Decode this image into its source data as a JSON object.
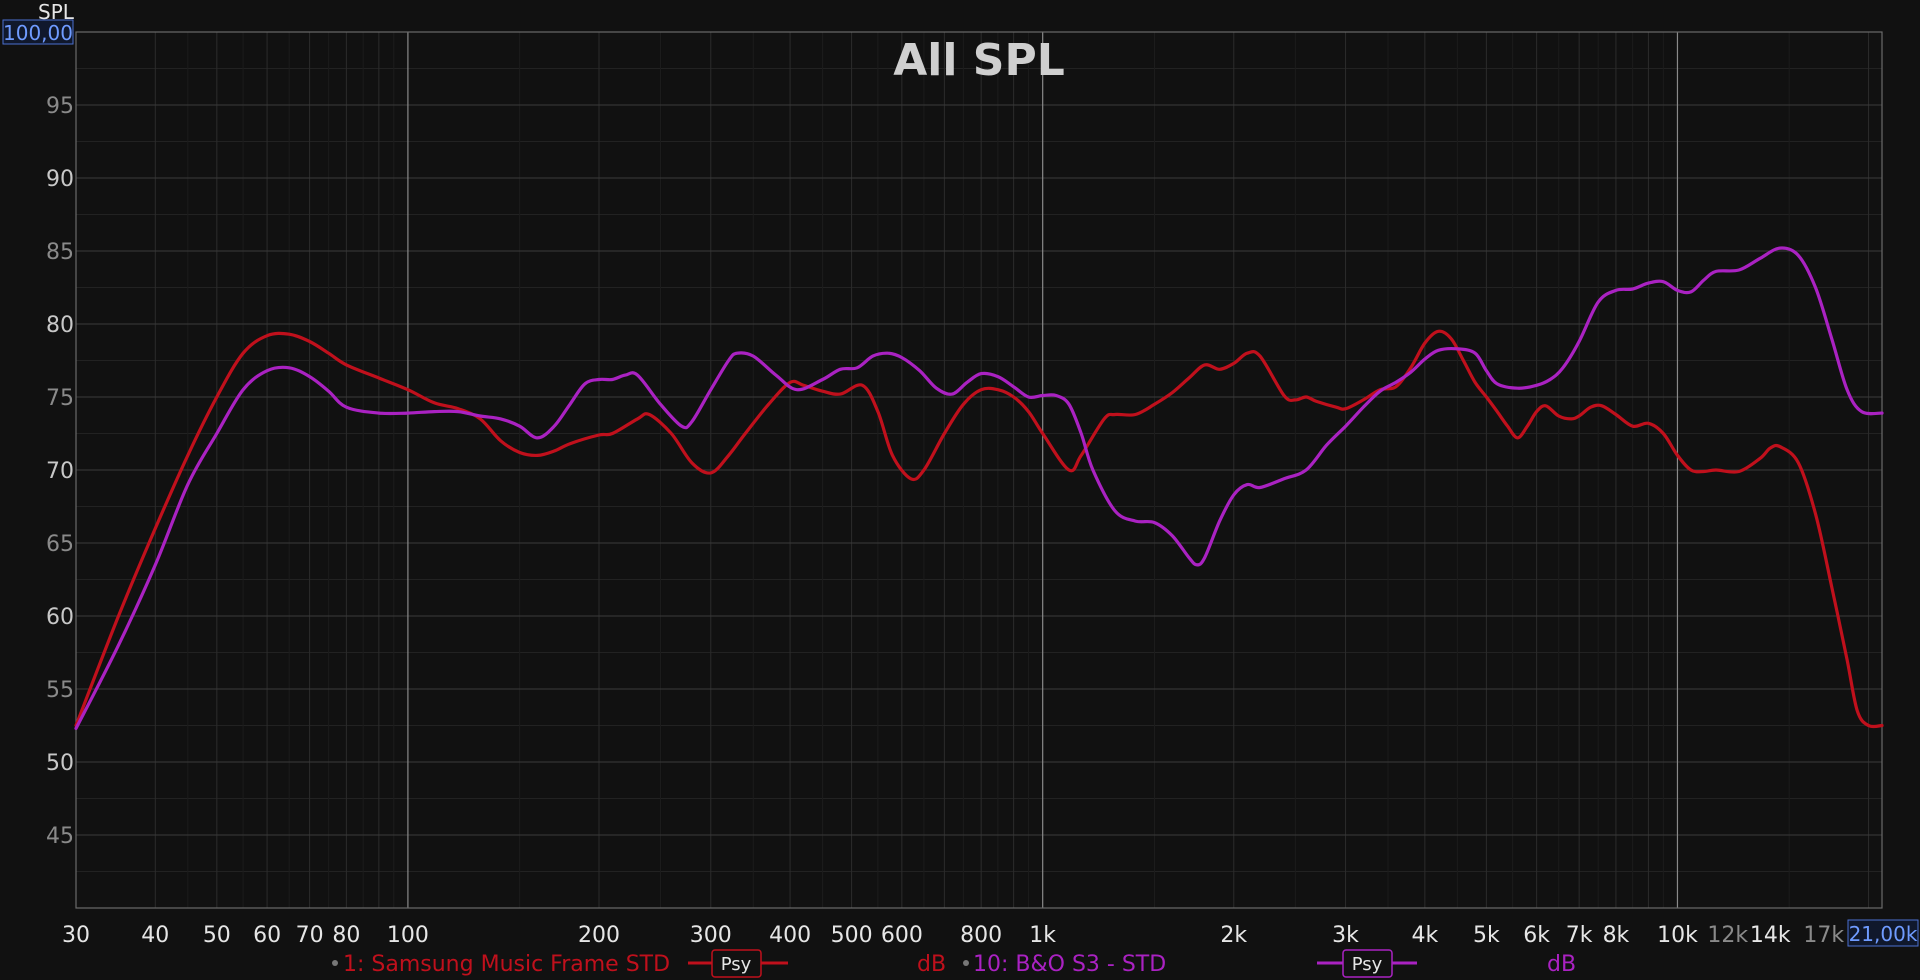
{
  "chart_data": {
    "type": "line",
    "title": "All SPL",
    "ylabel": "SPL",
    "xscale": "log",
    "xlim": [
      30,
      21000
    ],
    "ylim": [
      40,
      100
    ],
    "grid": true,
    "y_top_readout": "100,00",
    "x_right_readout": "21,00k",
    "y_ticks": [
      {
        "value": 95,
        "label": "95",
        "dim": true
      },
      {
        "value": 90,
        "label": "90",
        "dim": false
      },
      {
        "value": 85,
        "label": "85",
        "dim": true
      },
      {
        "value": 80,
        "label": "80",
        "dim": false
      },
      {
        "value": 75,
        "label": "75",
        "dim": true
      },
      {
        "value": 70,
        "label": "70",
        "dim": false
      },
      {
        "value": 65,
        "label": "65",
        "dim": true
      },
      {
        "value": 60,
        "label": "60",
        "dim": false
      },
      {
        "value": 55,
        "label": "55",
        "dim": true
      },
      {
        "value": 50,
        "label": "50",
        "dim": false
      },
      {
        "value": 45,
        "label": "45",
        "dim": true
      }
    ],
    "x_ticks": [
      {
        "value": 30,
        "label": "30",
        "dim": false
      },
      {
        "value": 40,
        "label": "40",
        "dim": false
      },
      {
        "value": 50,
        "label": "50",
        "dim": false
      },
      {
        "value": 60,
        "label": "60",
        "dim": false
      },
      {
        "value": 70,
        "label": "70",
        "dim": false
      },
      {
        "value": 80,
        "label": "80",
        "dim": false
      },
      {
        "value": 100,
        "label": "100",
        "dim": false
      },
      {
        "value": 200,
        "label": "200",
        "dim": false
      },
      {
        "value": 300,
        "label": "300",
        "dim": false
      },
      {
        "value": 400,
        "label": "400",
        "dim": false
      },
      {
        "value": 500,
        "label": "500",
        "dim": false
      },
      {
        "value": 600,
        "label": "600",
        "dim": false
      },
      {
        "value": 800,
        "label": "800",
        "dim": false
      },
      {
        "value": 1000,
        "label": "1k",
        "dim": false
      },
      {
        "value": 2000,
        "label": "2k",
        "dim": false
      },
      {
        "value": 3000,
        "label": "3k",
        "dim": false
      },
      {
        "value": 4000,
        "label": "4k",
        "dim": false
      },
      {
        "value": 5000,
        "label": "5k",
        "dim": false
      },
      {
        "value": 6000,
        "label": "6k",
        "dim": false
      },
      {
        "value": 7000,
        "label": "7k",
        "dim": false
      },
      {
        "value": 8000,
        "label": "8k",
        "dim": false
      },
      {
        "value": 10000,
        "label": "10k",
        "dim": false
      },
      {
        "value": 12000,
        "label": "12k",
        "dim": true
      },
      {
        "value": 14000,
        "label": "14k",
        "dim": false
      },
      {
        "value": 17000,
        "label": "17k",
        "dim": true
      }
    ],
    "series": [
      {
        "name": "1: Samsung Music Frame STD",
        "color": "#c0101c",
        "unit": "dB",
        "psy_label": "Psy",
        "points": [
          [
            30,
            52.5
          ],
          [
            35,
            60
          ],
          [
            40,
            66
          ],
          [
            45,
            71
          ],
          [
            50,
            75
          ],
          [
            55,
            78
          ],
          [
            60,
            79.2
          ],
          [
            65,
            79.3
          ],
          [
            70,
            78.8
          ],
          [
            75,
            78
          ],
          [
            80,
            77.2
          ],
          [
            90,
            76.3
          ],
          [
            100,
            75.5
          ],
          [
            110,
            74.6
          ],
          [
            120,
            74.2
          ],
          [
            130,
            73.5
          ],
          [
            140,
            72
          ],
          [
            150,
            71.2
          ],
          [
            160,
            71
          ],
          [
            170,
            71.3
          ],
          [
            180,
            71.8
          ],
          [
            200,
            72.4
          ],
          [
            210,
            72.5
          ],
          [
            230,
            73.5
          ],
          [
            240,
            73.8
          ],
          [
            260,
            72.5
          ],
          [
            280,
            70.5
          ],
          [
            300,
            69.8
          ],
          [
            320,
            71
          ],
          [
            340,
            72.5
          ],
          [
            370,
            74.5
          ],
          [
            400,
            76
          ],
          [
            420,
            75.8
          ],
          [
            450,
            75.4
          ],
          [
            480,
            75.2
          ],
          [
            520,
            75.8
          ],
          [
            550,
            74
          ],
          [
            580,
            71
          ],
          [
            620,
            69.4
          ],
          [
            650,
            70
          ],
          [
            700,
            72.5
          ],
          [
            750,
            74.5
          ],
          [
            800,
            75.5
          ],
          [
            850,
            75.5
          ],
          [
            900,
            75
          ],
          [
            950,
            74
          ],
          [
            1000,
            72.5
          ],
          [
            1100,
            70
          ],
          [
            1150,
            71
          ],
          [
            1250,
            73.5
          ],
          [
            1300,
            73.8
          ],
          [
            1400,
            73.8
          ],
          [
            1500,
            74.5
          ],
          [
            1600,
            75.3
          ],
          [
            1700,
            76.3
          ],
          [
            1800,
            77.2
          ],
          [
            1900,
            76.9
          ],
          [
            2000,
            77.3
          ],
          [
            2100,
            78
          ],
          [
            2200,
            77.8
          ],
          [
            2400,
            75.1
          ],
          [
            2500,
            74.8
          ],
          [
            2600,
            75
          ],
          [
            2700,
            74.7
          ],
          [
            2900,
            74.3
          ],
          [
            3000,
            74.2
          ],
          [
            3200,
            74.8
          ],
          [
            3400,
            75.5
          ],
          [
            3600,
            75.7
          ],
          [
            3800,
            77
          ],
          [
            4000,
            78.7
          ],
          [
            4200,
            79.5
          ],
          [
            4400,
            79
          ],
          [
            4600,
            77.5
          ],
          [
            4800,
            76
          ],
          [
            5000,
            75
          ],
          [
            5200,
            74
          ],
          [
            5400,
            73
          ],
          [
            5600,
            72.2
          ],
          [
            5800,
            73
          ],
          [
            6000,
            74
          ],
          [
            6200,
            74.4
          ],
          [
            6500,
            73.7
          ],
          [
            6800,
            73.5
          ],
          [
            7000,
            73.7
          ],
          [
            7300,
            74.3
          ],
          [
            7600,
            74.4
          ],
          [
            8000,
            73.8
          ],
          [
            8500,
            73
          ],
          [
            9000,
            73.2
          ],
          [
            9500,
            72.5
          ],
          [
            10000,
            71
          ],
          [
            10500,
            70
          ],
          [
            11000,
            69.9
          ],
          [
            11500,
            70
          ],
          [
            12500,
            69.9
          ],
          [
            13500,
            70.8
          ],
          [
            14000,
            71.5
          ],
          [
            14500,
            71.6
          ],
          [
            15500,
            70.5
          ],
          [
            16500,
            67
          ],
          [
            17500,
            62
          ],
          [
            18500,
            57
          ],
          [
            19200,
            53.5
          ],
          [
            20000,
            52.5
          ],
          [
            21000,
            52.5
          ]
        ]
      },
      {
        "name": "10: B&O S3 - STD",
        "color": "#aa22c2",
        "unit": "dB",
        "psy_label": "Psy",
        "points": [
          [
            30,
            52.3
          ],
          [
            35,
            58
          ],
          [
            40,
            63.5
          ],
          [
            45,
            69
          ],
          [
            50,
            72.5
          ],
          [
            55,
            75.5
          ],
          [
            60,
            76.8
          ],
          [
            65,
            77
          ],
          [
            70,
            76.4
          ],
          [
            75,
            75.4
          ],
          [
            80,
            74.3
          ],
          [
            90,
            73.9
          ],
          [
            100,
            73.9
          ],
          [
            110,
            74
          ],
          [
            120,
            74
          ],
          [
            130,
            73.7
          ],
          [
            140,
            73.5
          ],
          [
            150,
            73
          ],
          [
            160,
            72.2
          ],
          [
            170,
            73
          ],
          [
            180,
            74.5
          ],
          [
            190,
            75.9
          ],
          [
            200,
            76.2
          ],
          [
            210,
            76.2
          ],
          [
            220,
            76.5
          ],
          [
            230,
            76.5
          ],
          [
            250,
            74.5
          ],
          [
            270,
            73
          ],
          [
            280,
            73.3
          ],
          [
            300,
            75.5
          ],
          [
            320,
            77.5
          ],
          [
            330,
            78
          ],
          [
            350,
            77.8
          ],
          [
            380,
            76.5
          ],
          [
            410,
            75.5
          ],
          [
            450,
            76.2
          ],
          [
            480,
            76.9
          ],
          [
            510,
            77
          ],
          [
            540,
            77.8
          ],
          [
            570,
            78
          ],
          [
            600,
            77.7
          ],
          [
            640,
            76.8
          ],
          [
            680,
            75.6
          ],
          [
            720,
            75.2
          ],
          [
            760,
            76
          ],
          [
            800,
            76.6
          ],
          [
            850,
            76.4
          ],
          [
            900,
            75.7
          ],
          [
            950,
            75
          ],
          [
            1000,
            75.1
          ],
          [
            1050,
            75.1
          ],
          [
            1100,
            74.5
          ],
          [
            1150,
            72.5
          ],
          [
            1200,
            70
          ],
          [
            1300,
            67.2
          ],
          [
            1400,
            66.5
          ],
          [
            1500,
            66.4
          ],
          [
            1600,
            65.5
          ],
          [
            1700,
            64
          ],
          [
            1750,
            63.5
          ],
          [
            1800,
            64
          ],
          [
            1900,
            66.5
          ],
          [
            2000,
            68.3
          ],
          [
            2100,
            69
          ],
          [
            2200,
            68.8
          ],
          [
            2400,
            69.4
          ],
          [
            2600,
            70
          ],
          [
            2800,
            71.7
          ],
          [
            3000,
            73
          ],
          [
            3200,
            74.3
          ],
          [
            3400,
            75.4
          ],
          [
            3600,
            76
          ],
          [
            3800,
            76.7
          ],
          [
            4000,
            77.6
          ],
          [
            4200,
            78.2
          ],
          [
            4500,
            78.3
          ],
          [
            4800,
            78
          ],
          [
            5000,
            76.8
          ],
          [
            5200,
            75.9
          ],
          [
            5600,
            75.6
          ],
          [
            6000,
            75.8
          ],
          [
            6300,
            76.2
          ],
          [
            6600,
            77
          ],
          [
            7000,
            78.8
          ],
          [
            7500,
            81.5
          ],
          [
            8000,
            82.3
          ],
          [
            8500,
            82.4
          ],
          [
            9000,
            82.8
          ],
          [
            9500,
            82.9
          ],
          [
            10000,
            82.3
          ],
          [
            10500,
            82.2
          ],
          [
            11000,
            83
          ],
          [
            11500,
            83.6
          ],
          [
            12500,
            83.7
          ],
          [
            13500,
            84.5
          ],
          [
            14500,
            85.2
          ],
          [
            15500,
            84.7
          ],
          [
            16500,
            82.5
          ],
          [
            17500,
            79
          ],
          [
            18500,
            75.5
          ],
          [
            19500,
            74
          ],
          [
            21000,
            73.9
          ]
        ]
      }
    ]
  },
  "legend": {
    "psy_label": "Psy",
    "unit_label": "dB"
  }
}
